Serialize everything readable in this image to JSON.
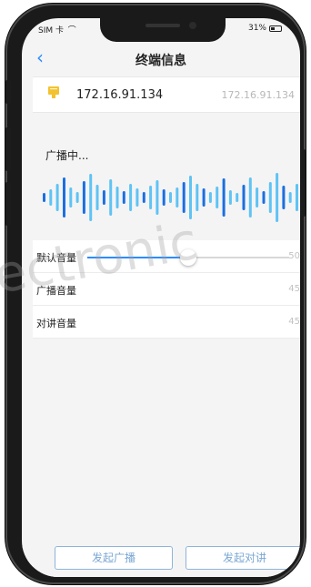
{
  "status_bar": {
    "carrier": "SIM 卡",
    "battery_percent": "31%"
  },
  "navbar": {
    "title": "终端信息"
  },
  "device": {
    "ip": "172.16.91.134",
    "ip_secondary": "172.16.91.134"
  },
  "broadcast": {
    "status_text": "广播中..."
  },
  "volumes": [
    {
      "label": "默认音量",
      "value": "50",
      "slider_level": 0.5
    },
    {
      "label": "广播音量",
      "value": "45"
    },
    {
      "label": "对讲音量",
      "value": "45"
    }
  ],
  "actions": {
    "start_broadcast": "发起广播",
    "start_intercom": "发起对讲"
  },
  "watermark": "ectronic",
  "colors": {
    "accent": "#2a8cff",
    "wave_light": "#5fc3f4",
    "wave_dark": "#1c6fe0"
  },
  "icons": {
    "back": "chevron-left-icon",
    "wifi": "wifi-icon",
    "battery": "battery-icon",
    "device": "speaker-device-icon"
  }
}
